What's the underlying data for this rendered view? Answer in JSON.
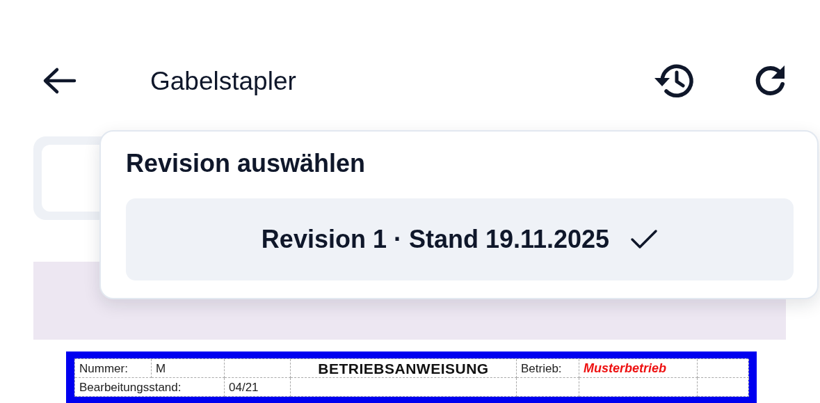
{
  "header": {
    "title": "Gabelstapler"
  },
  "revision_menu": {
    "title": "Revision auswählen",
    "items": [
      {
        "label": "Revision 1 · Stand 19.11.2025",
        "selected": true
      }
    ]
  },
  "document": {
    "number_label": "Nummer:",
    "number": "M",
    "title": "BETRIEBSANWEISUNG",
    "company_label": "Betrieb:",
    "company": "Musterbetrieb",
    "revision_label": "Bearbeitungsstand:",
    "revision": "04/21"
  }
}
